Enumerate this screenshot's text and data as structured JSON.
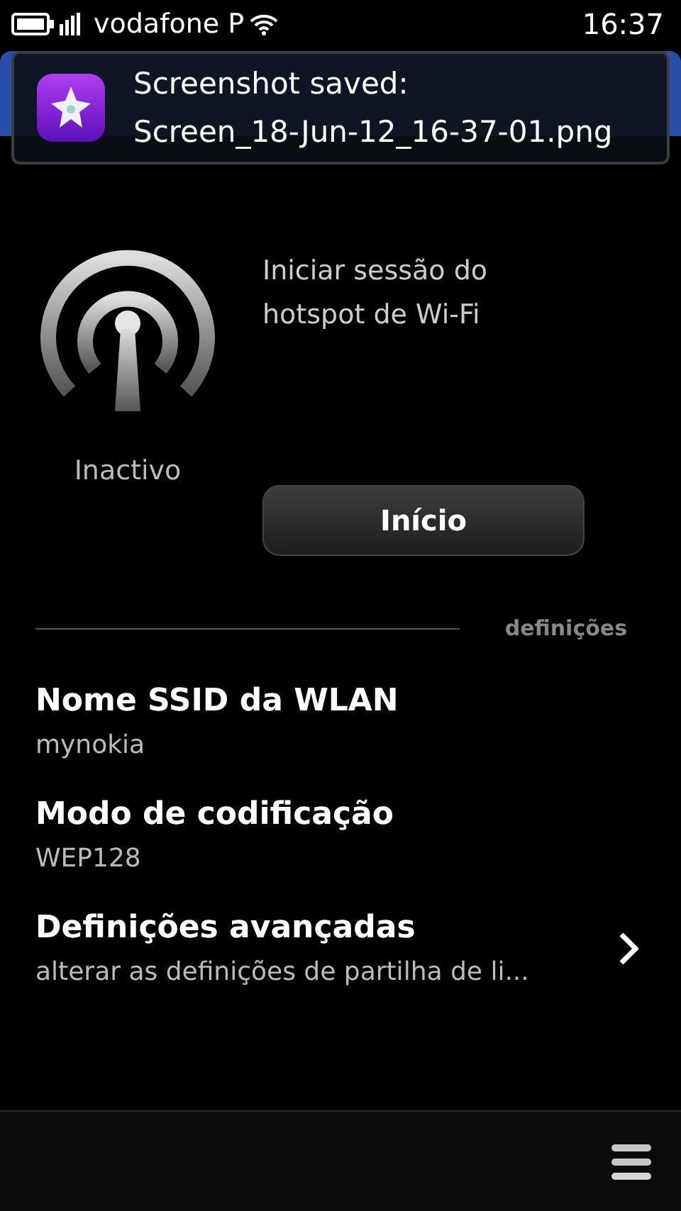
{
  "status_bar": {
    "carrier": "vodafone P",
    "time": "16:37"
  },
  "notification": {
    "title": "Screenshot saved:",
    "body": "Screen_18-Jun-12_16-37-01.png"
  },
  "hotspot": {
    "status": "Inactivo",
    "description": "Iniciar sessão do hotspot de Wi-Fi",
    "button": "Início"
  },
  "section": {
    "label": "definições"
  },
  "settings": [
    {
      "title": "Nome SSID da WLAN",
      "value": "mynokia",
      "has_arrow": false
    },
    {
      "title": "Modo de codificação",
      "value": "WEP128",
      "has_arrow": false
    },
    {
      "title": "Definições avançadas",
      "value": "alterar as definições de partilha de li...",
      "has_arrow": true
    }
  ]
}
